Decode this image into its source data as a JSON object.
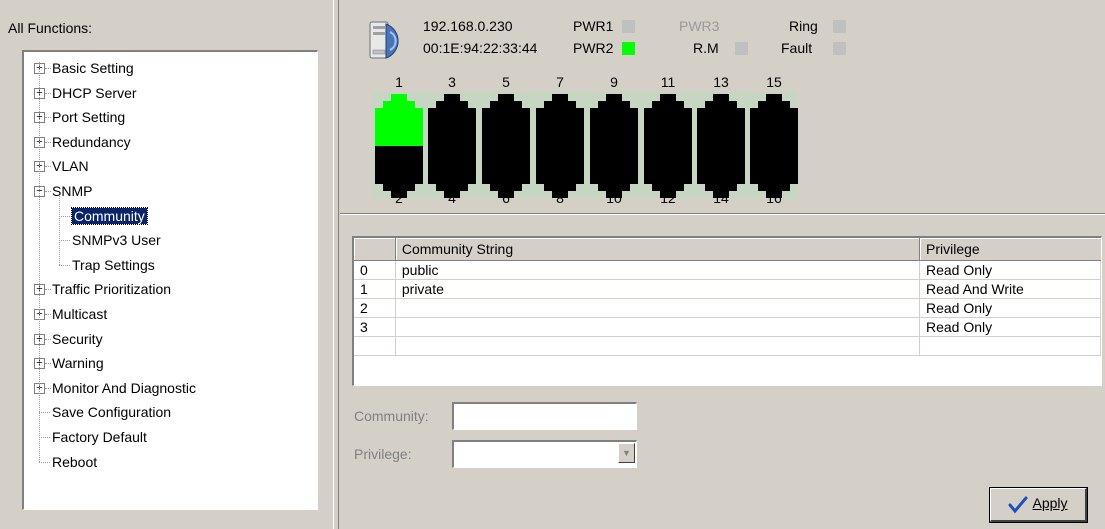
{
  "tree": {
    "title": "All Functions:",
    "items": [
      {
        "label": "Basic Setting",
        "expander": "+"
      },
      {
        "label": "DHCP Server",
        "expander": "+"
      },
      {
        "label": "Port Setting",
        "expander": "+"
      },
      {
        "label": "Redundancy",
        "expander": "+"
      },
      {
        "label": "VLAN",
        "expander": "+"
      },
      {
        "label": "SNMP",
        "expander": "−"
      },
      {
        "label": "Community"
      },
      {
        "label": "SNMPv3 User"
      },
      {
        "label": "Trap Settings"
      },
      {
        "label": "Traffic Prioritization",
        "expander": "+"
      },
      {
        "label": "Multicast",
        "expander": "+"
      },
      {
        "label": "Security",
        "expander": "+"
      },
      {
        "label": "Warning",
        "expander": "+"
      },
      {
        "label": "Monitor And Diagnostic",
        "expander": "+"
      },
      {
        "label": "Save Configuration"
      },
      {
        "label": "Factory Default"
      },
      {
        "label": "Reboot"
      }
    ],
    "selected": "Community"
  },
  "device": {
    "ip": "192.168.0.230",
    "mac": "00:1E:94:22:33:44",
    "indicators": {
      "pwr1": {
        "label": "PWR1",
        "state": "off"
      },
      "pwr2": {
        "label": "PWR2",
        "state": "on"
      },
      "pwr3": {
        "label": "PWR3",
        "state": "disabled"
      },
      "rm": {
        "label": "R.M",
        "state": "off"
      },
      "ring": {
        "label": "Ring",
        "state": "off"
      },
      "fault": {
        "label": "Fault",
        "state": "off"
      }
    },
    "ports_top": [
      "1",
      "3",
      "5",
      "7",
      "9",
      "11",
      "13",
      "15"
    ],
    "ports_bottom": [
      "2",
      "4",
      "6",
      "8",
      "10",
      "12",
      "14",
      "16"
    ],
    "active_ports": [
      "1"
    ],
    "colors": {
      "active": "#00ff00",
      "inactive": "#000000",
      "panel": "#c7d6c3"
    }
  },
  "table": {
    "headers": [
      "",
      "Community String",
      "Privilege"
    ],
    "rows": [
      [
        "0",
        "public",
        "Read Only"
      ],
      [
        "1",
        "private",
        "Read And Write"
      ],
      [
        "2",
        "",
        "Read Only"
      ],
      [
        "3",
        "",
        "Read Only"
      ]
    ]
  },
  "form": {
    "community_label": "Community:",
    "community_value": "",
    "privilege_label": "Privilege:",
    "privilege_value": ""
  },
  "apply_button": {
    "label": "Apply",
    "icon": "checkmark-icon"
  }
}
